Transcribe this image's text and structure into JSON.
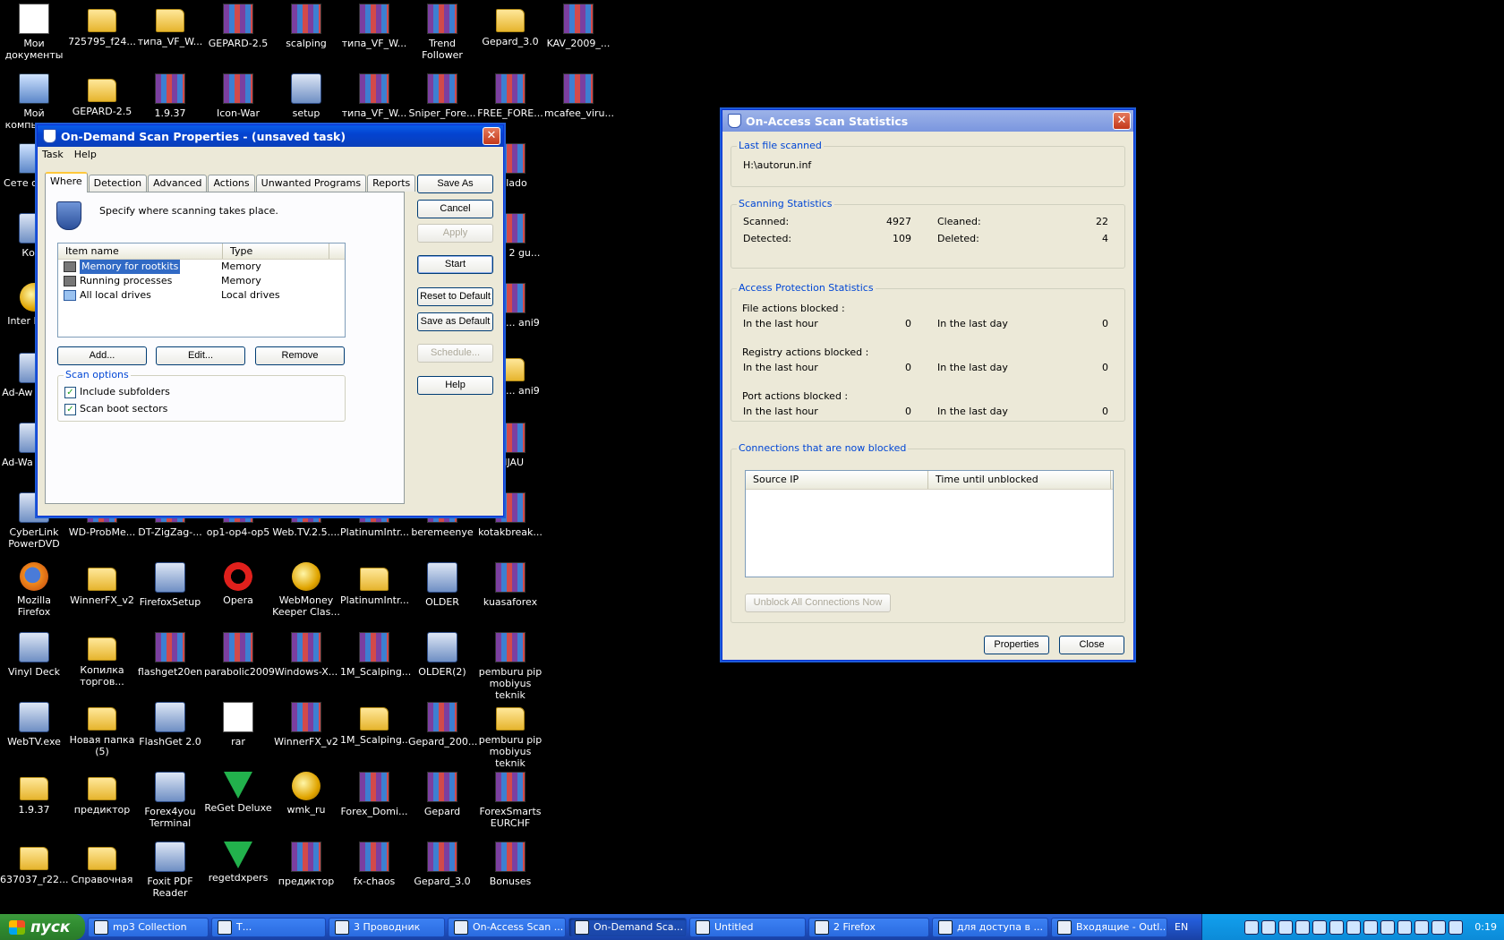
{
  "desktop": {
    "icons": [
      {
        "label": "Мои документы",
        "kind": "doc"
      },
      {
        "label": "725795_f24...",
        "kind": "folder"
      },
      {
        "label": "типа_VF_W...",
        "kind": "folder"
      },
      {
        "label": "GEPARD-2.5",
        "kind": "rar"
      },
      {
        "label": "scalping",
        "kind": "rar"
      },
      {
        "label": "типа_VF_W...",
        "kind": "rar"
      },
      {
        "label": "Trend Follower",
        "kind": "rar"
      },
      {
        "label": "Gepard_3.0",
        "kind": "folder"
      },
      {
        "label": "KAV_2009_...",
        "kind": "rar"
      },
      {
        "label": "Мой компьютер",
        "kind": "pc"
      },
      {
        "label": "GEPARD-2.5",
        "kind": "folder"
      },
      {
        "label": "1.9.37",
        "kind": "rar"
      },
      {
        "label": "Icon-War",
        "kind": "rar"
      },
      {
        "label": "setup",
        "kind": "exe"
      },
      {
        "label": "типа_VF_W...",
        "kind": "rar"
      },
      {
        "label": "Sniper_Fore...",
        "kind": "rar"
      },
      {
        "label": "FREE_FORE...",
        "kind": "rar"
      },
      {
        "label": "mcafee_viru...",
        "kind": "rar"
      },
      {
        "label": "Сете окруж",
        "kind": "pc"
      },
      {
        "label": "Корз",
        "kind": "exe"
      },
      {
        "label": "Inter Explo",
        "kind": "web"
      },
      {
        "label": "Ad-Aw Profes",
        "kind": "exe"
      },
      {
        "label": "Ad-Wa Profes",
        "kind": "exe"
      },
      {
        "label": "CyberLink PowerDVD",
        "kind": "exe"
      },
      {
        "label": "WD-ProbMe...",
        "kind": "rar"
      },
      {
        "label": "DT-ZigZag-...",
        "kind": "rar"
      },
      {
        "label": "op1-op4-op5",
        "kind": "rar"
      },
      {
        "label": "Web.TV.2.5....",
        "kind": "rar"
      },
      {
        "label": "PlatinumIntr...",
        "kind": "rar"
      },
      {
        "label": "beremeenye",
        "kind": "rar"
      },
      {
        "label": "kotakbreak...",
        "kind": "rar"
      },
      {
        "label": "yVlado",
        "kind": "rar"
      },
      {
        "label": "cator 2 gu...",
        "kind": "rar"
      },
      {
        "label": "or_te... ani9",
        "kind": "rar"
      },
      {
        "label": "or_te... ani9",
        "kind": "folder"
      },
      {
        "label": "HIJAU",
        "kind": "rar"
      },
      {
        "label": "Mozilla Firefox",
        "kind": "ff"
      },
      {
        "label": "WinnerFX_v2",
        "kind": "folder"
      },
      {
        "label": "FirefoxSetup",
        "kind": "exe"
      },
      {
        "label": "Opera",
        "kind": "opera"
      },
      {
        "label": "WebMoney Keeper Clas...",
        "kind": "web"
      },
      {
        "label": "PlatinumIntr...",
        "kind": "folder"
      },
      {
        "label": "OLDER",
        "kind": "exe"
      },
      {
        "label": "kuasaforex",
        "kind": "rar"
      },
      {
        "label": "Vinyl Deck",
        "kind": "exe"
      },
      {
        "label": "Копилка торгов...",
        "kind": "folder"
      },
      {
        "label": "flashget20en",
        "kind": "rar"
      },
      {
        "label": "parabolic2009",
        "kind": "rar"
      },
      {
        "label": "Windows-X...",
        "kind": "rar"
      },
      {
        "label": "1M_Scalping...",
        "kind": "rar"
      },
      {
        "label": "OLDER(2)",
        "kind": "exe"
      },
      {
        "label": "pemburu pip mobiyus teknik",
        "kind": "rar"
      },
      {
        "label": "WebTV.exe",
        "kind": "exe"
      },
      {
        "label": "Новая папка (5)",
        "kind": "folder"
      },
      {
        "label": "FlashGet 2.0",
        "kind": "exe"
      },
      {
        "label": "rar",
        "kind": "doc"
      },
      {
        "label": "WinnerFX_v2",
        "kind": "rar"
      },
      {
        "label": "1M_Scalping...",
        "kind": "folder"
      },
      {
        "label": "Gepard_200...",
        "kind": "rar"
      },
      {
        "label": "pemburu pip mobiyus teknik",
        "kind": "folder"
      },
      {
        "label": "1.9.37",
        "kind": "folder"
      },
      {
        "label": "предиктор",
        "kind": "folder"
      },
      {
        "label": "Forex4you Terminal",
        "kind": "exe"
      },
      {
        "label": "ReGet Deluxe",
        "kind": "green"
      },
      {
        "label": "wmk_ru",
        "kind": "web"
      },
      {
        "label": "Forex_Domi...",
        "kind": "rar"
      },
      {
        "label": "Gepard",
        "kind": "rar"
      },
      {
        "label": "ForexSmarts EURCHF",
        "kind": "rar"
      },
      {
        "label": "637037_r22...",
        "kind": "folder"
      },
      {
        "label": "Справочная",
        "kind": "folder"
      },
      {
        "label": "Foxit PDF Reader",
        "kind": "exe"
      },
      {
        "label": "regetdxpers",
        "kind": "green"
      },
      {
        "label": "предиктор",
        "kind": "rar"
      },
      {
        "label": "fx-chaos",
        "kind": "rar"
      },
      {
        "label": "Gepard_3.0",
        "kind": "rar"
      },
      {
        "label": "Bonuses",
        "kind": "rar"
      }
    ]
  },
  "ondemand": {
    "title": "On-Demand Scan Properties - (unsaved task)",
    "menu": [
      "Task",
      "Help"
    ],
    "tabs": [
      "Where",
      "Detection",
      "Advanced",
      "Actions",
      "Unwanted Programs",
      "Reports"
    ],
    "description": "Specify where scanning takes place.",
    "columns": [
      "Item name",
      "Type"
    ],
    "rows": [
      {
        "name": "Memory for rootkits",
        "type": "Memory"
      },
      {
        "name": "Running processes",
        "type": "Memory"
      },
      {
        "name": "All local drives",
        "type": "Local drives"
      }
    ],
    "list_buttons": {
      "add": "Add...",
      "edit": "Edit...",
      "remove": "Remove"
    },
    "scan_options": {
      "legend": "Scan options",
      "include_subfolders": "Include subfolders",
      "scan_boot_sectors": "Scan boot sectors"
    },
    "side_buttons": {
      "save_as": "Save As",
      "cancel": "Cancel",
      "apply": "Apply",
      "start": "Start",
      "reset": "Reset to Default",
      "save_default": "Save as Default",
      "schedule": "Schedule...",
      "help": "Help"
    }
  },
  "onaccess": {
    "title": "On-Access Scan Statistics",
    "last_file": {
      "legend": "Last file scanned",
      "value": "H:\\autorun.inf"
    },
    "scanning": {
      "legend": "Scanning Statistics",
      "scanned_label": "Scanned:",
      "scanned": "4927",
      "cleaned_label": "Cleaned:",
      "cleaned": "22",
      "detected_label": "Detected:",
      "detected": "109",
      "deleted_label": "Deleted:",
      "deleted": "4"
    },
    "access": {
      "legend": "Access Protection Statistics",
      "hour_label": "In the last hour",
      "day_label": "In the last day",
      "file_label": "File actions blocked :",
      "file_hour": "0",
      "file_day": "0",
      "registry_label": "Registry actions blocked :",
      "registry_hour": "0",
      "registry_day": "0",
      "port_label": "Port actions blocked :",
      "port_hour": "0",
      "port_day": "0"
    },
    "connections": {
      "legend": "Connections that are now blocked",
      "col1": "Source IP",
      "col2": "Time until unblocked",
      "unblock": "Unblock All Connections Now"
    },
    "buttons": {
      "properties": "Properties",
      "close": "Close"
    }
  },
  "taskbar": {
    "start": "пуск",
    "items": [
      {
        "label": "mp3 Collection"
      },
      {
        "label": "Т..."
      },
      {
        "label": "3 Проводник"
      },
      {
        "label": "On-Access Scan ..."
      },
      {
        "label": "On-Demand Sca..."
      },
      {
        "label": "Untitled"
      },
      {
        "label": "2 Firefox"
      },
      {
        "label": "для доступа в ..."
      },
      {
        "label": "Входящие - Outl..."
      }
    ],
    "lang": "EN",
    "clock": "0:19"
  },
  "colors": {
    "title_active": "#0a5ee8",
    "group_legend": "#0046d5",
    "selection": "#316ac5"
  }
}
